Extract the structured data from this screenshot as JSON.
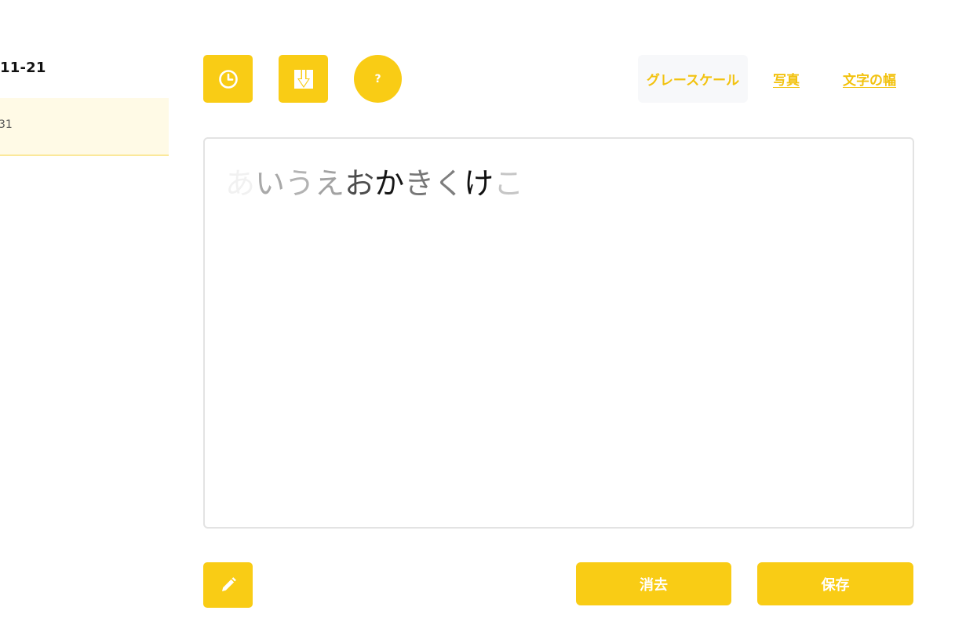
{
  "sidebar": {
    "date": "11-21",
    "entries": [
      {
        "label": "31"
      }
    ]
  },
  "toolbar": {
    "history_icon": "clock-icon",
    "download_icon": "download-icon",
    "help_label": "?",
    "tabs": [
      {
        "label": "グレースケール",
        "active": true
      },
      {
        "label": "写真",
        "active": false
      },
      {
        "label": "文字の幅",
        "active": false
      }
    ]
  },
  "editor": {
    "chars": [
      {
        "char": "あ",
        "color": "#f1f1f1"
      },
      {
        "char": "い",
        "color": "#a9a9a9"
      },
      {
        "char": "う",
        "color": "#b3b3b3"
      },
      {
        "char": "え",
        "color": "#a2a2a2"
      },
      {
        "char": "お",
        "color": "#4d4d4d"
      },
      {
        "char": "か",
        "color": "#161616"
      },
      {
        "char": "き",
        "color": "#777777"
      },
      {
        "char": "く",
        "color": "#7e7e7e"
      },
      {
        "char": "け",
        "color": "#111111"
      },
      {
        "char": "こ",
        "color": "#c6c6c6"
      }
    ]
  },
  "footer": {
    "edit_icon": "pencil-icon",
    "clear_label": "消去",
    "save_label": "保存"
  },
  "colors": {
    "accent": "#f9cc15",
    "accent_text": "#f2c20f",
    "sidebar_highlight": "#fffae6"
  }
}
